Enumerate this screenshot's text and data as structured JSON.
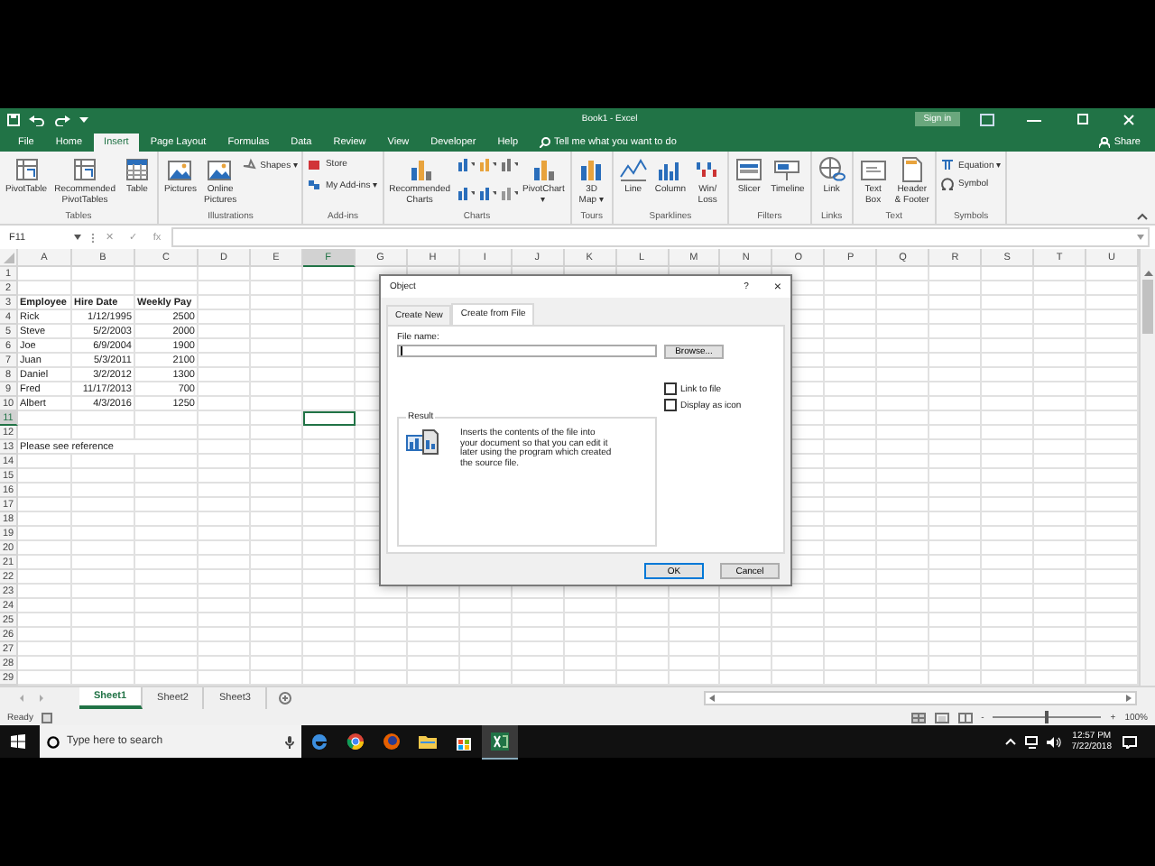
{
  "window": {
    "title": "Book1 - Excel",
    "sign_in": "Sign in"
  },
  "tabs": [
    {
      "label": "File",
      "selected": false
    },
    {
      "label": "Home",
      "selected": false
    },
    {
      "label": "Insert",
      "selected": true
    },
    {
      "label": "Page Layout",
      "selected": false
    },
    {
      "label": "Formulas",
      "selected": false
    },
    {
      "label": "Data",
      "selected": false
    },
    {
      "label": "Review",
      "selected": false
    },
    {
      "label": "View",
      "selected": false
    },
    {
      "label": "Developer",
      "selected": false
    },
    {
      "label": "Help",
      "selected": false
    }
  ],
  "tell_me": "Tell me what you want to do",
  "share": "Share",
  "ribbon_groups": [
    {
      "label": "Tables",
      "commands": [
        {
          "kind": "large",
          "label": "PivotTable"
        },
        {
          "kind": "large",
          "label": "Recommended\nPivotTables"
        },
        {
          "kind": "large",
          "label": "Table"
        }
      ]
    },
    {
      "label": "Illustrations",
      "commands": [
        {
          "kind": "large",
          "label": "Pictures"
        },
        {
          "kind": "large",
          "label": "Online\nPictures"
        },
        {
          "kind": "small",
          "label": "Shapes ▾"
        }
      ]
    },
    {
      "label": "Add-ins",
      "commands": [
        {
          "kind": "small",
          "label": "Store"
        },
        {
          "kind": "small",
          "label": "My Add-ins ▾"
        }
      ]
    },
    {
      "label": "Charts",
      "commands": [
        {
          "kind": "large",
          "label": "Recommended\nCharts"
        },
        {
          "kind": "chart-icons"
        },
        {
          "kind": "large",
          "label": "PivotChart\n▾"
        }
      ]
    },
    {
      "label": "Tours",
      "commands": [
        {
          "kind": "large",
          "label": "3D\nMap ▾"
        }
      ]
    },
    {
      "label": "Sparklines",
      "commands": [
        {
          "kind": "large",
          "label": "Line"
        },
        {
          "kind": "large",
          "label": "Column"
        },
        {
          "kind": "large",
          "label": "Win/\nLoss"
        }
      ]
    },
    {
      "label": "Filters",
      "commands": [
        {
          "kind": "large",
          "label": "Slicer"
        },
        {
          "kind": "large",
          "label": "Timeline"
        }
      ]
    },
    {
      "label": "Links",
      "commands": [
        {
          "kind": "large",
          "label": "Link"
        }
      ]
    },
    {
      "label": "Text",
      "commands": [
        {
          "kind": "large",
          "label": "Text\nBox"
        },
        {
          "kind": "large",
          "label": "Header\n& Footer"
        }
      ]
    },
    {
      "label": "Symbols",
      "commands": [
        {
          "kind": "small",
          "label": "Equation ▾"
        },
        {
          "kind": "small",
          "label": "Symbol"
        }
      ]
    }
  ],
  "formula_bar": {
    "name_box": "F11",
    "buttons": [
      "✕",
      "✓",
      "fx"
    ]
  },
  "columns": [
    {
      "label": "A",
      "selected": false
    },
    {
      "label": "B",
      "selected": false
    },
    {
      "label": "C",
      "selected": false
    },
    {
      "label": "D",
      "selected": false
    },
    {
      "label": "E",
      "selected": false
    },
    {
      "label": "F",
      "selected": true
    },
    {
      "label": "G",
      "selected": false
    },
    {
      "label": "H",
      "selected": false
    },
    {
      "label": "I",
      "selected": false
    },
    {
      "label": "J",
      "selected": false
    },
    {
      "label": "K",
      "selected": false
    },
    {
      "label": "L",
      "selected": false
    },
    {
      "label": "M",
      "selected": false
    },
    {
      "label": "N",
      "selected": false
    },
    {
      "label": "O",
      "selected": false
    },
    {
      "label": "P",
      "selected": false
    },
    {
      "label": "Q",
      "selected": false
    },
    {
      "label": "R",
      "selected": false
    },
    {
      "label": "S",
      "selected": false
    },
    {
      "label": "T",
      "selected": false
    },
    {
      "label": "U",
      "selected": false
    }
  ],
  "rows": [
    {
      "number": "1",
      "selected": false
    },
    {
      "number": "2",
      "selected": false
    },
    {
      "number": "3",
      "selected": false,
      "kind": "header",
      "cells": [
        "Employee",
        "Hire Date",
        "Weekly Pay"
      ]
    },
    {
      "number": "4",
      "selected": false,
      "cells": [
        "Rick",
        "1/12/1995",
        "2500"
      ]
    },
    {
      "number": "5",
      "selected": false,
      "cells": [
        "Steve",
        "5/2/2003",
        "2000"
      ]
    },
    {
      "number": "6",
      "selected": false,
      "cells": [
        "Joe",
        "6/9/2004",
        "1900"
      ]
    },
    {
      "number": "7",
      "selected": false,
      "cells": [
        "Juan",
        "5/3/2011",
        "2100"
      ]
    },
    {
      "number": "8",
      "selected": false,
      "cells": [
        "Daniel",
        "3/2/2012",
        "1300"
      ]
    },
    {
      "number": "9",
      "selected": false,
      "cells": [
        "Fred",
        "11/17/2013",
        "700"
      ]
    },
    {
      "number": "10",
      "selected": false,
      "cells": [
        "Albert",
        "4/3/2016",
        "1250"
      ]
    },
    {
      "number": "11",
      "selected": true
    },
    {
      "number": "12",
      "selected": false
    },
    {
      "number": "13",
      "selected": false,
      "kind": "note",
      "cells": [
        "Please see reference"
      ]
    },
    {
      "number": "14",
      "selected": false
    },
    {
      "number": "15",
      "selected": false
    },
    {
      "number": "16",
      "selected": false
    },
    {
      "number": "17",
      "selected": false
    },
    {
      "number": "18",
      "selected": false
    },
    {
      "number": "19",
      "selected": false
    },
    {
      "number": "20",
      "selected": false
    },
    {
      "number": "21",
      "selected": false
    },
    {
      "number": "22",
      "selected": false
    },
    {
      "number": "23",
      "selected": false
    },
    {
      "number": "24",
      "selected": false
    },
    {
      "number": "25",
      "selected": false
    },
    {
      "number": "26",
      "selected": false
    },
    {
      "number": "27",
      "selected": false
    },
    {
      "number": "28",
      "selected": false
    },
    {
      "number": "29",
      "selected": false
    }
  ],
  "sheet_tabs": [
    {
      "label": "Sheet1",
      "selected": true
    },
    {
      "label": "Sheet2",
      "selected": false
    },
    {
      "label": "Sheet3",
      "selected": false
    }
  ],
  "status_bar": {
    "text": "Ready",
    "zoom_minus": "-",
    "zoom_plus": "+",
    "zoom_slider": {
      "level": 0.5
    },
    "zoom": "100%"
  },
  "dialog": {
    "title": "Object",
    "help": "?",
    "close": "×",
    "tabs": [
      {
        "label": "Create New",
        "selected": false
      },
      {
        "label": "Create from File",
        "selected": true
      }
    ],
    "file_label": "File name:",
    "browse": "Browse...",
    "options": [
      {
        "label": "Link to file",
        "checked": false
      },
      {
        "label": "Display as icon",
        "checked": false
      }
    ],
    "result_title": "Result",
    "result_text": "Inserts the contents of the file into your document so that you can edit it later using the program which created the source file.",
    "buttons": [
      {
        "label": "OK",
        "default": true
      },
      {
        "label": "Cancel",
        "default": false
      }
    ]
  },
  "taskbar": {
    "search_placeholder": "Type here to search",
    "time": "12:57 PM",
    "date": "7/22/2018"
  }
}
